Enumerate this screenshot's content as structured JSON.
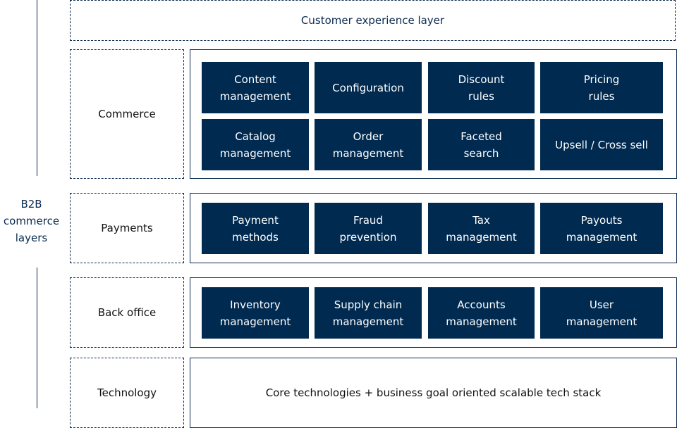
{
  "side_label": "B2B\ncommerce\nlayers",
  "top_layer": "Customer experience layer",
  "layers": [
    {
      "label": "Commerce",
      "tiles": [
        "Content\nmanagement",
        "Configuration",
        "Discount\nrules",
        "Pricing\nrules",
        "Catalog\nmanagement",
        "Order\nmanagement",
        "Faceted\nsearch",
        "Upsell / Cross sell"
      ]
    },
    {
      "label": "Payments",
      "tiles": [
        "Payment\nmethods",
        "Fraud\nprevention",
        "Tax\nmanagement",
        "Payouts\nmanagement"
      ]
    },
    {
      "label": "Back office",
      "tiles": [
        "Inventory\nmanagement",
        "Supply chain\nmanagement",
        "Accounts\nmanagement",
        "User\nmanagement"
      ]
    },
    {
      "label": "Technology",
      "text": "Core technologies + business goal oriented scalable tech stack"
    }
  ],
  "colors": {
    "navy": "#002a50",
    "line": "#0a2a4f"
  }
}
